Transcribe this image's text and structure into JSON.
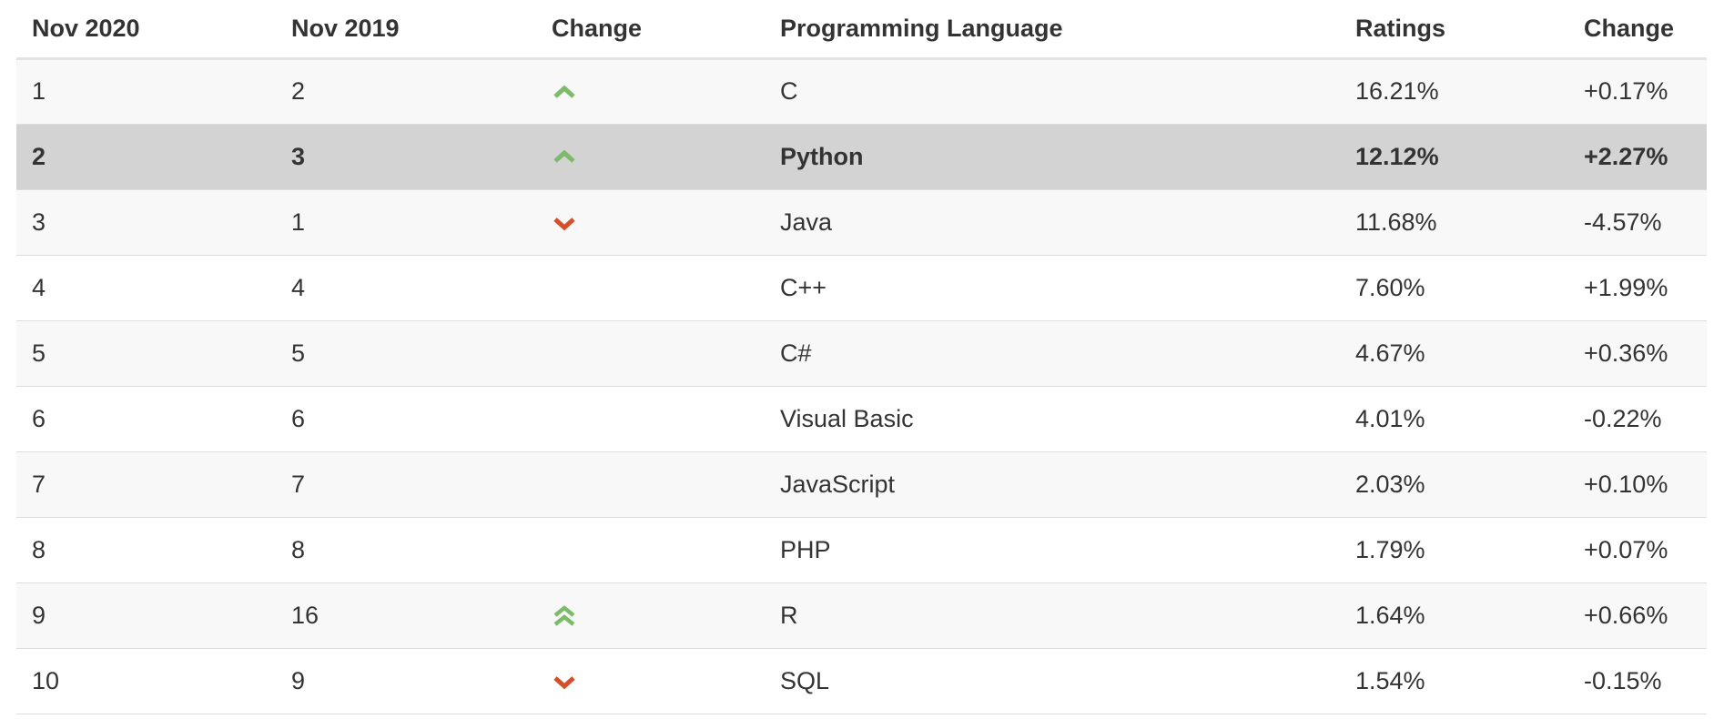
{
  "table": {
    "headers": [
      "Nov 2020",
      "Nov 2019",
      "Change",
      "Programming Language",
      "Ratings",
      "Change"
    ],
    "colors": {
      "up": "#7dbb6a",
      "down": "#d4502a"
    },
    "rows": [
      {
        "rank": "1",
        "prev": "2",
        "trend": "up",
        "trend_icon": "chevron-up-icon",
        "language": "C",
        "rating": "16.21%",
        "delta": "+0.17%"
      },
      {
        "rank": "2",
        "prev": "3",
        "trend": "up",
        "trend_icon": "chevron-up-icon",
        "language": "Python",
        "rating": "12.12%",
        "delta": "+2.27%"
      },
      {
        "rank": "3",
        "prev": "1",
        "trend": "down",
        "trend_icon": "chevron-down-icon",
        "language": "Java",
        "rating": "11.68%",
        "delta": "-4.57%"
      },
      {
        "rank": "4",
        "prev": "4",
        "trend": "none",
        "trend_icon": "",
        "language": "C++",
        "rating": "7.60%",
        "delta": "+1.99%"
      },
      {
        "rank": "5",
        "prev": "5",
        "trend": "none",
        "trend_icon": "",
        "language": "C#",
        "rating": "4.67%",
        "delta": "+0.36%"
      },
      {
        "rank": "6",
        "prev": "6",
        "trend": "none",
        "trend_icon": "",
        "language": "Visual Basic",
        "rating": "4.01%",
        "delta": "-0.22%"
      },
      {
        "rank": "7",
        "prev": "7",
        "trend": "none",
        "trend_icon": "",
        "language": "JavaScript",
        "rating": "2.03%",
        "delta": "+0.10%"
      },
      {
        "rank": "8",
        "prev": "8",
        "trend": "none",
        "trend_icon": "",
        "language": "PHP",
        "rating": "1.79%",
        "delta": "+0.07%"
      },
      {
        "rank": "9",
        "prev": "16",
        "trend": "double-up",
        "trend_icon": "double-chevron-up-icon",
        "language": "R",
        "rating": "1.64%",
        "delta": "+0.66%"
      },
      {
        "rank": "10",
        "prev": "9",
        "trend": "down",
        "trend_icon": "chevron-down-icon",
        "language": "SQL",
        "rating": "1.54%",
        "delta": "-0.15%"
      }
    ]
  }
}
